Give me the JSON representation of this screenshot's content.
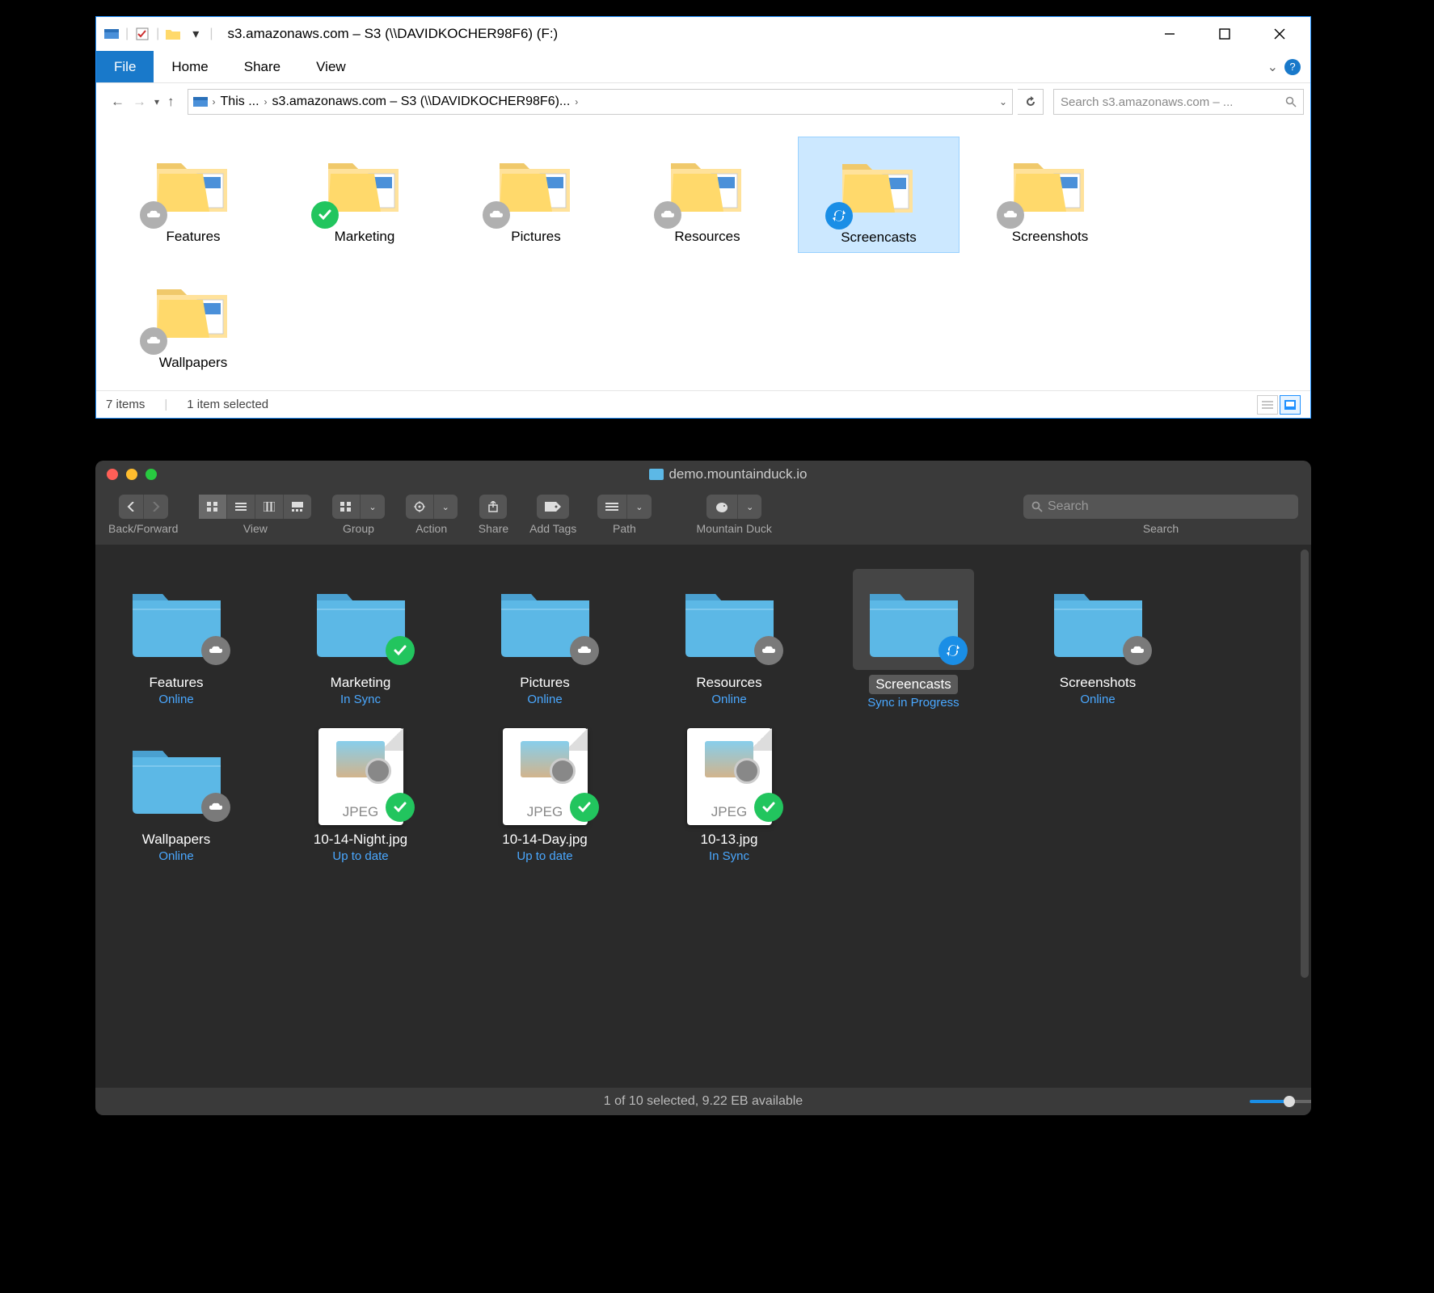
{
  "windows": {
    "title": "s3.amazonaws.com – S3 (\\\\DAVIDKOCHER98F6) (F:)",
    "ribbon": {
      "file": "File",
      "home": "Home",
      "share": "Share",
      "view": "View"
    },
    "breadcrumb": {
      "root": "This ...",
      "path": "s3.amazonaws.com – S3 (\\\\DAVIDKOCHER98F6)..."
    },
    "search_placeholder": "Search s3.amazonaws.com – ...",
    "items": [
      {
        "name": "Features",
        "badge": "cloud"
      },
      {
        "name": "Marketing",
        "badge": "check"
      },
      {
        "name": "Pictures",
        "badge": "cloud"
      },
      {
        "name": "Resources",
        "badge": "cloud"
      },
      {
        "name": "Screencasts",
        "badge": "sync",
        "selected": true
      },
      {
        "name": "Screenshots",
        "badge": "cloud"
      },
      {
        "name": "Wallpapers",
        "badge": "cloud"
      }
    ],
    "status_count": "7 items",
    "status_selected": "1 item selected"
  },
  "mac": {
    "title": "demo.mountainduck.io",
    "toolbar": {
      "back_forward": "Back/Forward",
      "view": "View",
      "group": "Group",
      "action": "Action",
      "share": "Share",
      "add_tags": "Add Tags",
      "path": "Path",
      "mountain_duck": "Mountain Duck",
      "search": "Search",
      "search_placeholder": "Search"
    },
    "items": [
      {
        "name": "Features",
        "status": "Online",
        "badge": "cloud",
        "kind": "folder"
      },
      {
        "name": "Marketing",
        "status": "In Sync",
        "badge": "check",
        "kind": "folder"
      },
      {
        "name": "Pictures",
        "status": "Online",
        "badge": "cloud",
        "kind": "folder"
      },
      {
        "name": "Resources",
        "status": "Online",
        "badge": "cloud",
        "kind": "folder"
      },
      {
        "name": "Screencasts",
        "status": "Sync in Progress",
        "badge": "sync",
        "kind": "folder",
        "selected": true
      },
      {
        "name": "Screenshots",
        "status": "Online",
        "badge": "cloud",
        "kind": "folder"
      },
      {
        "name": "Wallpapers",
        "status": "Online",
        "badge": "cloud",
        "kind": "folder"
      },
      {
        "name": "10-14-Night.jpg",
        "status": "Up to date",
        "badge": "check",
        "kind": "file",
        "ftype": "JPEG"
      },
      {
        "name": "10-14-Day.jpg",
        "status": "Up to date",
        "badge": "check",
        "kind": "file",
        "ftype": "JPEG"
      },
      {
        "name": "10-13.jpg",
        "status": "In Sync",
        "badge": "check",
        "kind": "file",
        "ftype": "JPEG"
      }
    ],
    "status": "1 of 10 selected, 9.22 EB available"
  }
}
